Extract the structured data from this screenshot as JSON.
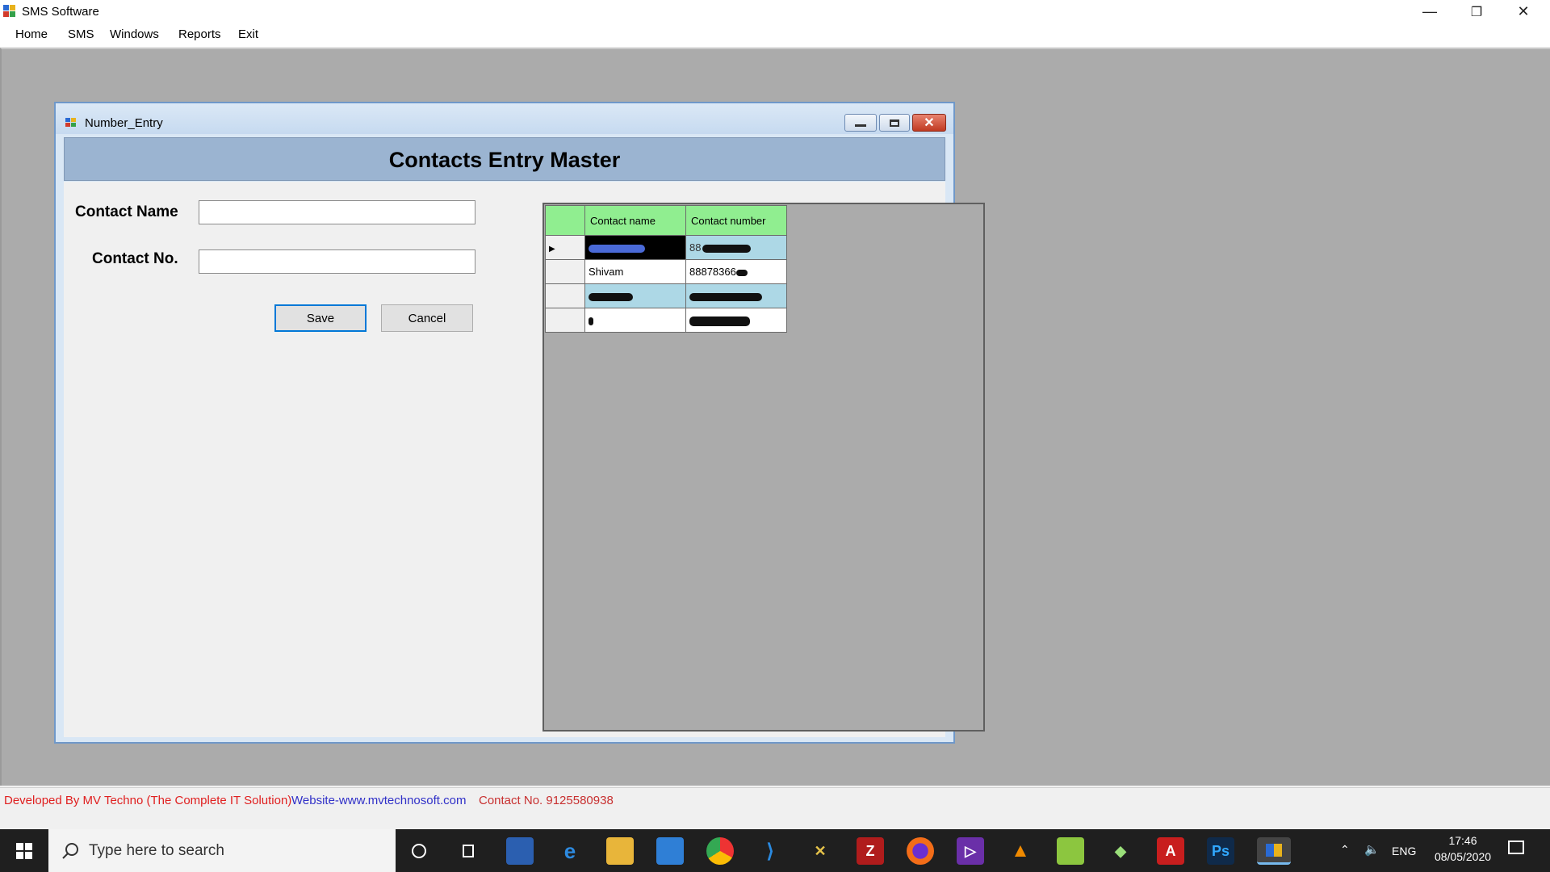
{
  "app": {
    "title": "SMS Software",
    "menu": [
      "Home",
      "SMS",
      "Windows",
      "Reports",
      "Exit"
    ]
  },
  "window_controls": {
    "minimize": "—",
    "restore": "❐",
    "close": "✕"
  },
  "child_window": {
    "title": "Number_Entry",
    "header": "Contacts Entry Master",
    "form": {
      "contact_name_label": "Contact Name",
      "contact_no_label": "Contact No.",
      "contact_name_value": "",
      "contact_no_value": "",
      "save_label": "Save",
      "cancel_label": "Cancel"
    },
    "grid": {
      "columns": [
        "Contact name",
        "Contact number"
      ],
      "rows": [
        {
          "name": "",
          "number": "88",
          "selected": true
        },
        {
          "name": "Shivam",
          "number": "88878366",
          "selected": false
        },
        {
          "name": "",
          "number": "",
          "selected": false
        },
        {
          "name": "",
          "number": "",
          "selected": false
        }
      ],
      "colors": {
        "header": "#90ee90",
        "alt_row": "#add8e6"
      }
    }
  },
  "status": {
    "developer": "Developed By MV Techno (The Complete IT Solution)",
    "website": "Website-www.mvtechnosoft.com",
    "contact": "Contact No. 9125580938",
    "colors": {
      "developer": "#e02020",
      "website": "#3030c8",
      "contact": "#c83030"
    }
  },
  "taskbar": {
    "search_placeholder": "Type here to search",
    "language": "ENG",
    "time": "17:46",
    "date": "08/05/2020",
    "icons": [
      "cortana-icon",
      "task-view-icon",
      "store-icon",
      "edge-icon",
      "file-explorer-icon",
      "mail-icon",
      "chrome-icon",
      "vscode-icon",
      "tools-icon",
      "filezilla-icon",
      "firefox-icon",
      "visual-studio-icon",
      "vlc-icon",
      "notepadpp-icon",
      "app-icon",
      "acrobat-icon",
      "photoshop-icon",
      "sms-app-icon"
    ]
  }
}
